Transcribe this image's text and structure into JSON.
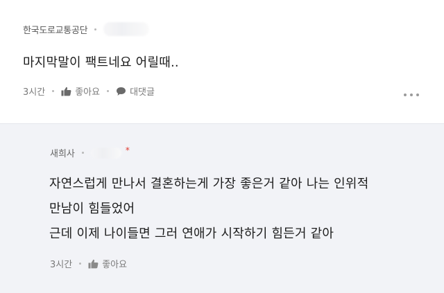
{
  "comment": {
    "author": "한국도로교통공단",
    "text": "마지막말이 팩트네요 어릴때..",
    "time": "3시간",
    "like_label": "좋아요",
    "reply_label": "대댓글"
  },
  "reply": {
    "author": "새희사",
    "author_suffix": "*",
    "lines": [
      "자연스럽게 만나서 결혼하는게 가장 좋은거 같아 나는  인위적",
      "만남이 힘들었어",
      "근데 이제 나이들면 그러 연애가 시작하기 힘든거 같아"
    ],
    "time": "3시간",
    "like_label": "좋아요"
  },
  "colors": {
    "reply_bg": "#f2f3f7",
    "accent_star": "#e0382e"
  }
}
